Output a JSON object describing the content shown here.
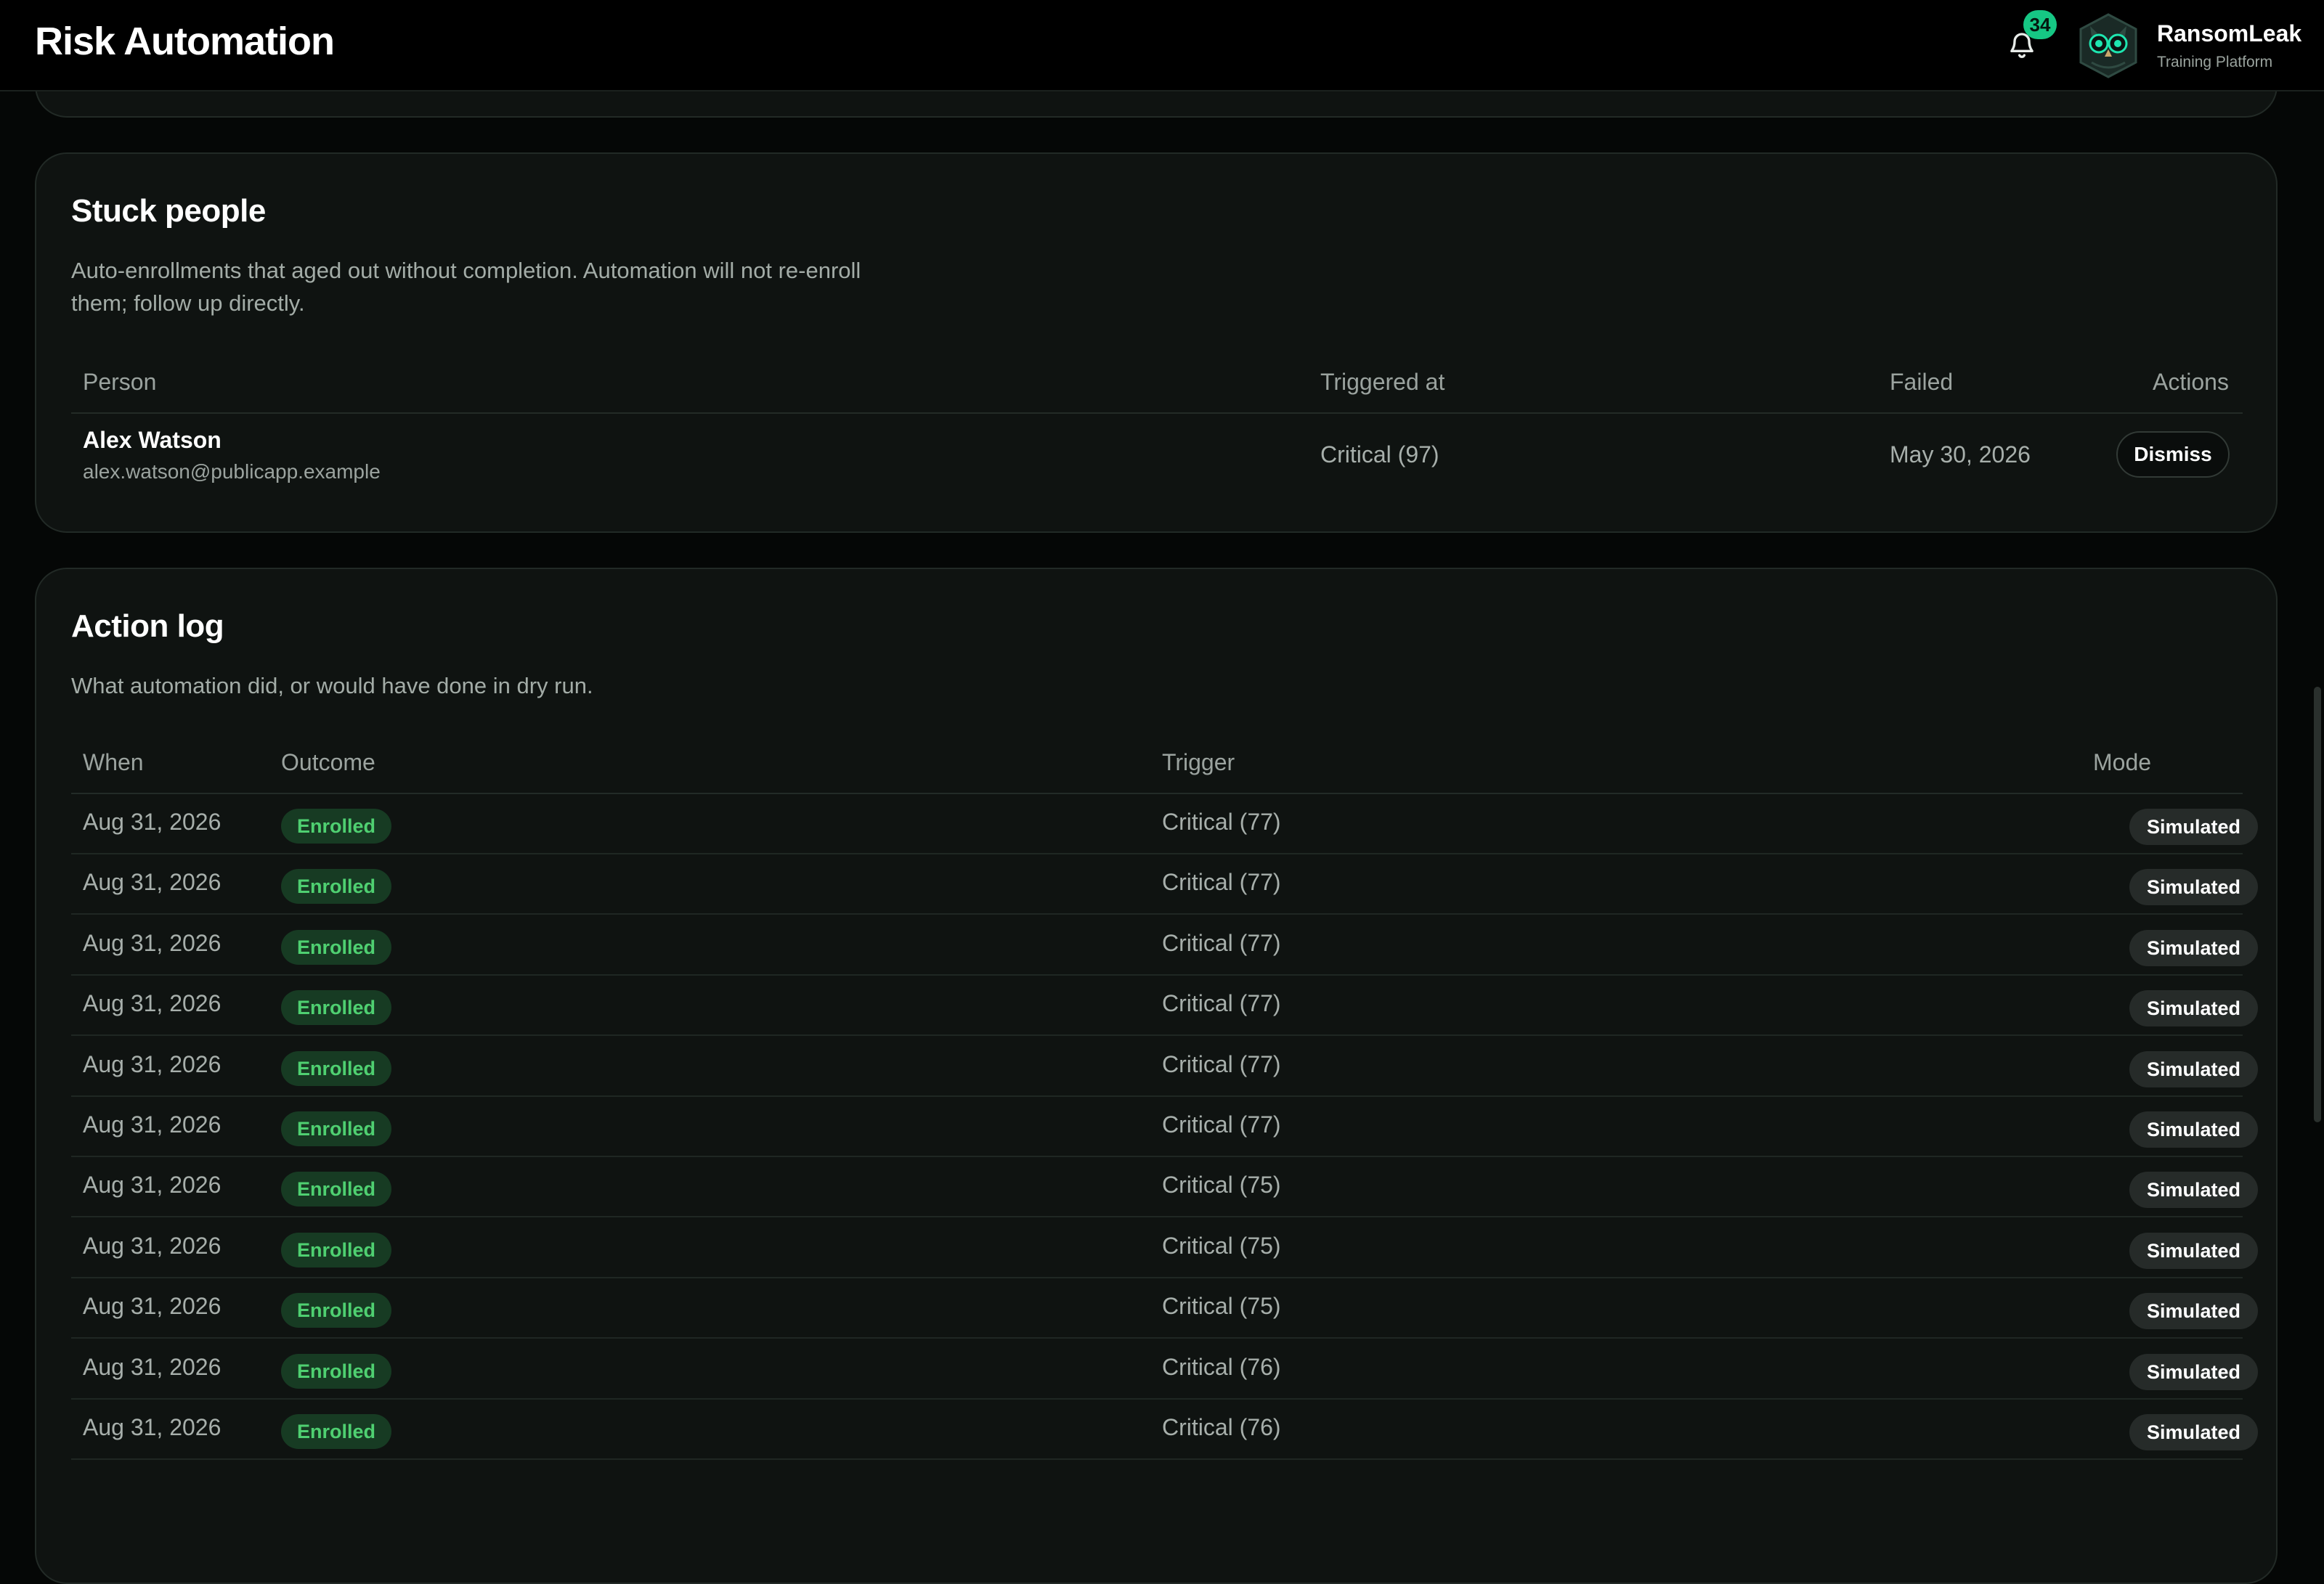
{
  "header": {
    "title": "Risk Automation",
    "notifications_count": "34",
    "brand_name": "RansomLeak",
    "brand_subtitle": "Training Platform"
  },
  "stuck": {
    "title": "Stuck people",
    "description_line1": "Auto-enrollments that aged out without completion. Automation will not re-enroll",
    "description_line2": "them; follow up directly.",
    "columns": {
      "person": "Person",
      "triggered_at": "Triggered at",
      "failed": "Failed",
      "actions": "Actions"
    },
    "rows": [
      {
        "name": "Alex Watson",
        "email": "alex.watson@publicapp.example",
        "triggered_at": "Critical (97)",
        "failed": "May 30, 2026",
        "action_label": "Dismiss"
      }
    ]
  },
  "log": {
    "title": "Action log",
    "description": "What automation did, or would have done in dry run.",
    "columns": {
      "when": "When",
      "outcome": "Outcome",
      "trigger": "Trigger",
      "mode": "Mode"
    },
    "rows": [
      {
        "when": "Aug 31, 2026",
        "outcome": "Enrolled",
        "trigger": "Critical (77)",
        "mode": "Simulated"
      },
      {
        "when": "Aug 31, 2026",
        "outcome": "Enrolled",
        "trigger": "Critical (77)",
        "mode": "Simulated"
      },
      {
        "when": "Aug 31, 2026",
        "outcome": "Enrolled",
        "trigger": "Critical (77)",
        "mode": "Simulated"
      },
      {
        "when": "Aug 31, 2026",
        "outcome": "Enrolled",
        "trigger": "Critical (77)",
        "mode": "Simulated"
      },
      {
        "when": "Aug 31, 2026",
        "outcome": "Enrolled",
        "trigger": "Critical (77)",
        "mode": "Simulated"
      },
      {
        "when": "Aug 31, 2026",
        "outcome": "Enrolled",
        "trigger": "Critical (77)",
        "mode": "Simulated"
      },
      {
        "when": "Aug 31, 2026",
        "outcome": "Enrolled",
        "trigger": "Critical (75)",
        "mode": "Simulated"
      },
      {
        "when": "Aug 31, 2026",
        "outcome": "Enrolled",
        "trigger": "Critical (75)",
        "mode": "Simulated"
      },
      {
        "when": "Aug 31, 2026",
        "outcome": "Enrolled",
        "trigger": "Critical (75)",
        "mode": "Simulated"
      },
      {
        "when": "Aug 31, 2026",
        "outcome": "Enrolled",
        "trigger": "Critical (76)",
        "mode": "Simulated"
      },
      {
        "when": "Aug 31, 2026",
        "outcome": "Enrolled",
        "trigger": "Critical (76)",
        "mode": "Simulated"
      }
    ]
  },
  "icons": {
    "notifications": "bell-icon",
    "avatar": "owl-avatar-icon"
  },
  "colors": {
    "accent": "#16c784",
    "enrolled_text": "#4fd071",
    "enrolled_bg": "#173b23",
    "card_bg": "#0f1311",
    "page_bg": "#050706"
  }
}
